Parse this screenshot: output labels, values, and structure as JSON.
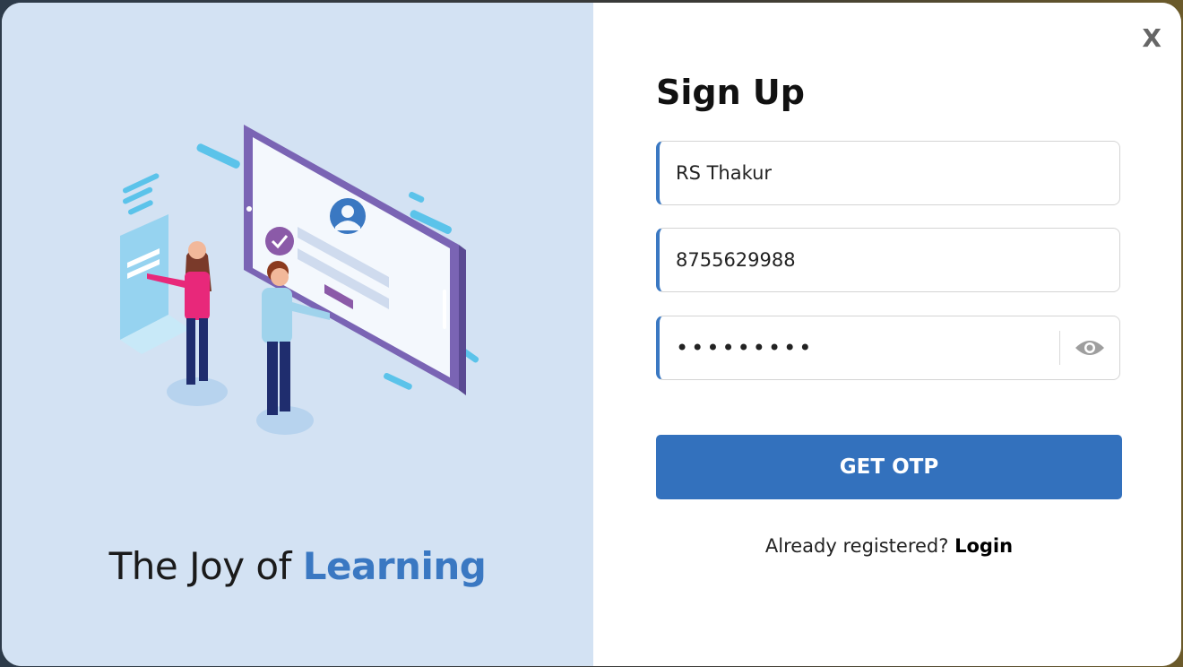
{
  "modal": {
    "close_label": "X"
  },
  "left": {
    "tagline_prefix": "The Joy of ",
    "tagline_accent": "Learning"
  },
  "form": {
    "title": "Sign Up",
    "name_value": "RS Thakur",
    "phone_value": "8755629988",
    "password_value": "123456789",
    "submit_label": "GET OTP",
    "login_prompt": "Already registered? ",
    "login_link": "Login"
  },
  "colors": {
    "accent": "#3a78c2",
    "button": "#3371bd",
    "left_panel_bg": "#d3e2f3"
  },
  "icons": {
    "close": "close-icon",
    "eye": "eye-icon"
  }
}
